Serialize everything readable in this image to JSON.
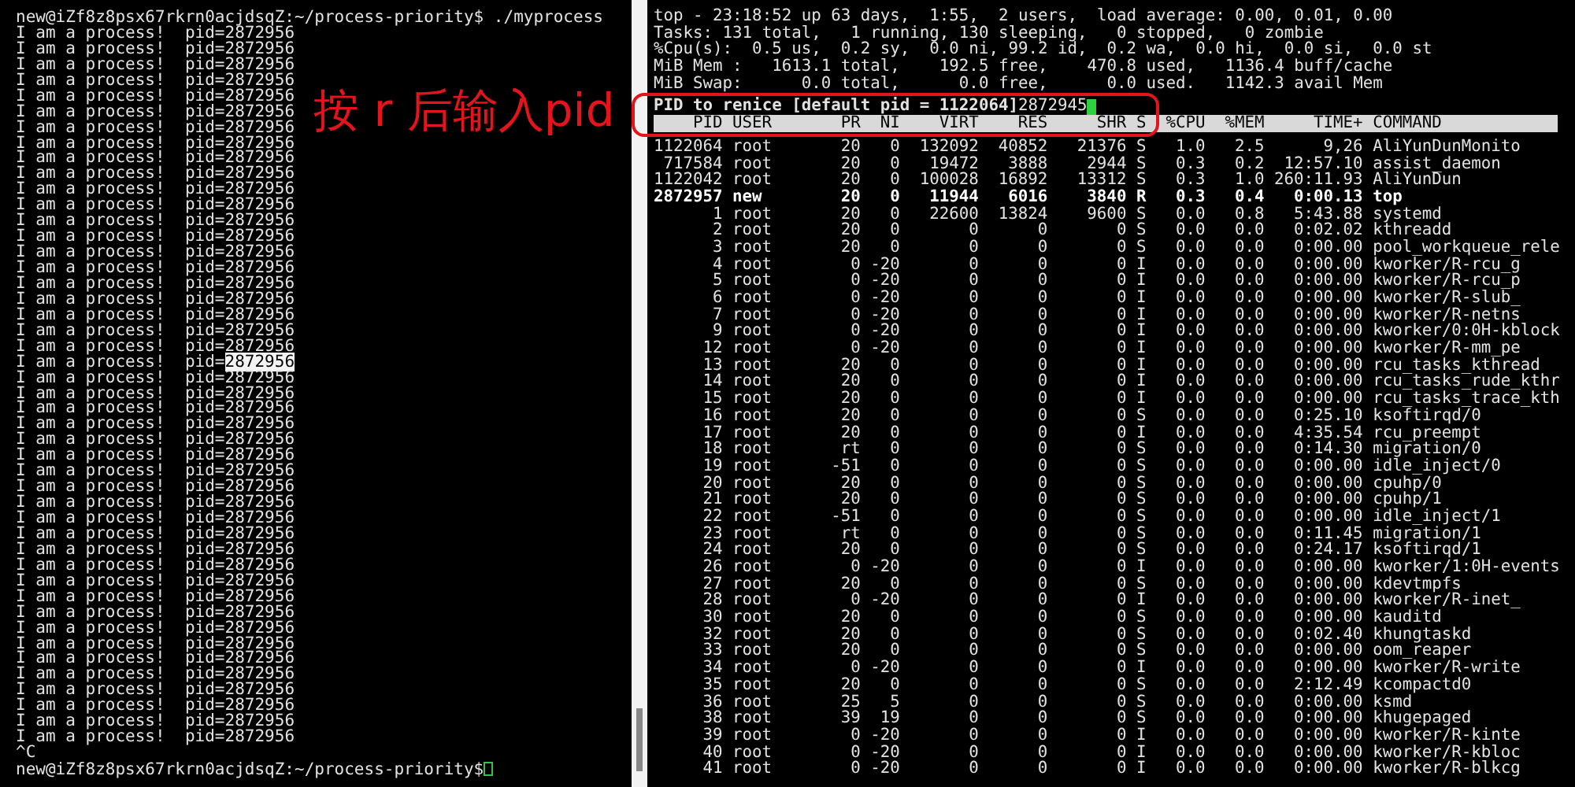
{
  "left_terminal": {
    "command_line": "new@iZf8z8psx67rkrn0acjdsqZ:~/process-priority$ ./myprocess",
    "output_lines": [
      {
        "text": "I am a process!  pid=",
        "pid": "2872956",
        "selected": false
      },
      {
        "text": "I am a process!  pid=",
        "pid": "2872956",
        "selected": false
      },
      {
        "text": "I am a process!  pid=",
        "pid": "2872956",
        "selected": false
      },
      {
        "text": "I am a process!  pid=",
        "pid": "2872956",
        "selected": false
      },
      {
        "text": "I am a process!  pid=",
        "pid": "2872956",
        "selected": false
      },
      {
        "text": "I am a process!  pid=",
        "pid": "2872956",
        "selected": false
      },
      {
        "text": "I am a process!  pid=",
        "pid": "2872956",
        "selected": false
      },
      {
        "text": "I am a process!  pid=",
        "pid": "2872956",
        "selected": false
      },
      {
        "text": "I am a process!  pid=",
        "pid": "2872956",
        "selected": false
      },
      {
        "text": "I am a process!  pid=",
        "pid": "2872956",
        "selected": false
      },
      {
        "text": "I am a process!  pid=",
        "pid": "2872956",
        "selected": false
      },
      {
        "text": "I am a process!  pid=",
        "pid": "2872956",
        "selected": false
      },
      {
        "text": "I am a process!  pid=",
        "pid": "2872956",
        "selected": false
      },
      {
        "text": "I am a process!  pid=",
        "pid": "2872956",
        "selected": false
      },
      {
        "text": "I am a process!  pid=",
        "pid": "2872956",
        "selected": false
      },
      {
        "text": "I am a process!  pid=",
        "pid": "2872956",
        "selected": false
      },
      {
        "text": "I am a process!  pid=",
        "pid": "2872956",
        "selected": false
      },
      {
        "text": "I am a process!  pid=",
        "pid": "2872956",
        "selected": false
      },
      {
        "text": "I am a process!  pid=",
        "pid": "2872956",
        "selected": false
      },
      {
        "text": "I am a process!  pid=",
        "pid": "2872956",
        "selected": false
      },
      {
        "text": "I am a process!  pid=",
        "pid": "2872956",
        "selected": false
      },
      {
        "text": "I am a process!  pid=",
        "pid": "2872956",
        "selected": true
      },
      {
        "text": "I am a process!  pid=",
        "pid": "2872956",
        "selected": false
      },
      {
        "text": "I am a process!  pid=",
        "pid": "2872956",
        "selected": false
      },
      {
        "text": "I am a process!  pid=",
        "pid": "2872956",
        "selected": false
      },
      {
        "text": "I am a process!  pid=",
        "pid": "2872956",
        "selected": false
      },
      {
        "text": "I am a process!  pid=",
        "pid": "2872956",
        "selected": false
      },
      {
        "text": "I am a process!  pid=",
        "pid": "2872956",
        "selected": false
      },
      {
        "text": "I am a process!  pid=",
        "pid": "2872956",
        "selected": false
      },
      {
        "text": "I am a process!  pid=",
        "pid": "2872956",
        "selected": false
      },
      {
        "text": "I am a process!  pid=",
        "pid": "2872956",
        "selected": false
      },
      {
        "text": "I am a process!  pid=",
        "pid": "2872956",
        "selected": false
      },
      {
        "text": "I am a process!  pid=",
        "pid": "2872956",
        "selected": false
      },
      {
        "text": "I am a process!  pid=",
        "pid": "2872956",
        "selected": false
      },
      {
        "text": "I am a process!  pid=",
        "pid": "2872956",
        "selected": false
      },
      {
        "text": "I am a process!  pid=",
        "pid": "2872956",
        "selected": false
      },
      {
        "text": "I am a process!  pid=",
        "pid": "2872956",
        "selected": false
      },
      {
        "text": "I am a process!  pid=",
        "pid": "2872956",
        "selected": false
      },
      {
        "text": "I am a process!  pid=",
        "pid": "2872956",
        "selected": false
      },
      {
        "text": "I am a process!  pid=",
        "pid": "2872956",
        "selected": false
      },
      {
        "text": "I am a process!  pid=",
        "pid": "2872956",
        "selected": false
      },
      {
        "text": "I am a process!  pid=",
        "pid": "2872956",
        "selected": false
      },
      {
        "text": "I am a process!  pid=",
        "pid": "2872956",
        "selected": false
      },
      {
        "text": "I am a process!  pid=",
        "pid": "2872956",
        "selected": false
      },
      {
        "text": "I am a process!  pid=",
        "pid": "2872956",
        "selected": false
      },
      {
        "text": "I am a process!  pid=",
        "pid": "2872956",
        "selected": false
      }
    ],
    "interrupt": "^C",
    "prompt": "new@iZf8z8psx67rkrn0acjdsqZ:~/process-priority$"
  },
  "annotation": {
    "text": "按 r 后输入pid"
  },
  "top": {
    "summary_lines": [
      "top - 23:18:52 up 63 days,  1:55,  2 users,  load average: 0.00, 0.01, 0.00",
      "Tasks: 131 total,   1 running, 130 sleeping,   0 stopped,   0 zombie",
      "%Cpu(s):  0.5 us,  0.2 sy,  0.0 ni, 99.2 id,  0.2 wa,  0.0 hi,  0.0 si,  0.0 st",
      "MiB Mem :   1613.1 total,    192.5 free,    470.8 used,   1136.4 buff/cache",
      "MiB Swap:      0.0 total,      0.0 free,      0.0 used.   1142.3 avail Mem"
    ],
    "renice_prompt": "PID to renice [default pid = 1122064]",
    "renice_input": "2872945",
    "columns": [
      "PID",
      "USER",
      "PR",
      "NI",
      "VIRT",
      "RES",
      "SHR",
      "S",
      "%CPU",
      "%MEM",
      "TIME+",
      "COMMAND"
    ],
    "rows": [
      {
        "cells": [
          "1122064",
          "root",
          "20",
          "0",
          "132092",
          "40852",
          "21376",
          "S",
          "1.0",
          "2.5",
          "9,26",
          "AliYunDunMonito"
        ],
        "highlighted": false
      },
      {
        "cells": [
          "717584",
          "root",
          "20",
          "0",
          "19472",
          "3888",
          "2944",
          "S",
          "0.3",
          "0.2",
          "12:57.10",
          "assist_daemon"
        ],
        "highlighted": false
      },
      {
        "cells": [
          "1122042",
          "root",
          "20",
          "0",
          "100028",
          "16892",
          "13312",
          "S",
          "0.3",
          "1.0",
          "260:11.93",
          "AliYunDun"
        ],
        "highlighted": false
      },
      {
        "cells": [
          "2872957",
          "new",
          "20",
          "0",
          "11944",
          "6016",
          "3840",
          "R",
          "0.3",
          "0.4",
          "0:00.13",
          "top"
        ],
        "highlighted": true
      },
      {
        "cells": [
          "1",
          "root",
          "20",
          "0",
          "22600",
          "13824",
          "9600",
          "S",
          "0.0",
          "0.8",
          "5:43.88",
          "systemd"
        ],
        "highlighted": false
      },
      {
        "cells": [
          "2",
          "root",
          "20",
          "0",
          "0",
          "0",
          "0",
          "S",
          "0.0",
          "0.0",
          "0:02.02",
          "kthreadd"
        ],
        "highlighted": false
      },
      {
        "cells": [
          "3",
          "root",
          "20",
          "0",
          "0",
          "0",
          "0",
          "S",
          "0.0",
          "0.0",
          "0:00.00",
          "pool_workqueue_rele"
        ],
        "highlighted": false
      },
      {
        "cells": [
          "4",
          "root",
          "0",
          "-20",
          "0",
          "0",
          "0",
          "I",
          "0.0",
          "0.0",
          "0:00.00",
          "kworker/R-rcu_g"
        ],
        "highlighted": false
      },
      {
        "cells": [
          "5",
          "root",
          "0",
          "-20",
          "0",
          "0",
          "0",
          "I",
          "0.0",
          "0.0",
          "0:00.00",
          "kworker/R-rcu_p"
        ],
        "highlighted": false
      },
      {
        "cells": [
          "6",
          "root",
          "0",
          "-20",
          "0",
          "0",
          "0",
          "I",
          "0.0",
          "0.0",
          "0:00.00",
          "kworker/R-slub_"
        ],
        "highlighted": false
      },
      {
        "cells": [
          "7",
          "root",
          "0",
          "-20",
          "0",
          "0",
          "0",
          "I",
          "0.0",
          "0.0",
          "0:00.00",
          "kworker/R-netns"
        ],
        "highlighted": false
      },
      {
        "cells": [
          "9",
          "root",
          "0",
          "-20",
          "0",
          "0",
          "0",
          "I",
          "0.0",
          "0.0",
          "0:00.00",
          "kworker/0:0H-kblock"
        ],
        "highlighted": false
      },
      {
        "cells": [
          "12",
          "root",
          "0",
          "-20",
          "0",
          "0",
          "0",
          "I",
          "0.0",
          "0.0",
          "0:00.00",
          "kworker/R-mm_pe"
        ],
        "highlighted": false
      },
      {
        "cells": [
          "13",
          "root",
          "20",
          "0",
          "0",
          "0",
          "0",
          "I",
          "0.0",
          "0.0",
          "0:00.00",
          "rcu_tasks_kthread"
        ],
        "highlighted": false
      },
      {
        "cells": [
          "14",
          "root",
          "20",
          "0",
          "0",
          "0",
          "0",
          "I",
          "0.0",
          "0.0",
          "0:00.00",
          "rcu_tasks_rude_kthr"
        ],
        "highlighted": false
      },
      {
        "cells": [
          "15",
          "root",
          "20",
          "0",
          "0",
          "0",
          "0",
          "I",
          "0.0",
          "0.0",
          "0:00.00",
          "rcu_tasks_trace_kth"
        ],
        "highlighted": false
      },
      {
        "cells": [
          "16",
          "root",
          "20",
          "0",
          "0",
          "0",
          "0",
          "S",
          "0.0",
          "0.0",
          "0:25.10",
          "ksoftirqd/0"
        ],
        "highlighted": false
      },
      {
        "cells": [
          "17",
          "root",
          "20",
          "0",
          "0",
          "0",
          "0",
          "I",
          "0.0",
          "0.0",
          "4:35.54",
          "rcu_preempt"
        ],
        "highlighted": false
      },
      {
        "cells": [
          "18",
          "root",
          "rt",
          "0",
          "0",
          "0",
          "0",
          "S",
          "0.0",
          "0.0",
          "0:14.30",
          "migration/0"
        ],
        "highlighted": false
      },
      {
        "cells": [
          "19",
          "root",
          "-51",
          "0",
          "0",
          "0",
          "0",
          "S",
          "0.0",
          "0.0",
          "0:00.00",
          "idle_inject/0"
        ],
        "highlighted": false
      },
      {
        "cells": [
          "20",
          "root",
          "20",
          "0",
          "0",
          "0",
          "0",
          "S",
          "0.0",
          "0.0",
          "0:00.00",
          "cpuhp/0"
        ],
        "highlighted": false
      },
      {
        "cells": [
          "21",
          "root",
          "20",
          "0",
          "0",
          "0",
          "0",
          "S",
          "0.0",
          "0.0",
          "0:00.00",
          "cpuhp/1"
        ],
        "highlighted": false
      },
      {
        "cells": [
          "22",
          "root",
          "-51",
          "0",
          "0",
          "0",
          "0",
          "S",
          "0.0",
          "0.0",
          "0:00.00",
          "idle_inject/1"
        ],
        "highlighted": false
      },
      {
        "cells": [
          "23",
          "root",
          "rt",
          "0",
          "0",
          "0",
          "0",
          "S",
          "0.0",
          "0.0",
          "0:11.45",
          "migration/1"
        ],
        "highlighted": false
      },
      {
        "cells": [
          "24",
          "root",
          "20",
          "0",
          "0",
          "0",
          "0",
          "S",
          "0.0",
          "0.0",
          "0:24.17",
          "ksoftirqd/1"
        ],
        "highlighted": false
      },
      {
        "cells": [
          "26",
          "root",
          "0",
          "-20",
          "0",
          "0",
          "0",
          "I",
          "0.0",
          "0.0",
          "0:00.00",
          "kworker/1:0H-events"
        ],
        "highlighted": false
      },
      {
        "cells": [
          "27",
          "root",
          "20",
          "0",
          "0",
          "0",
          "0",
          "S",
          "0.0",
          "0.0",
          "0:00.00",
          "kdevtmpfs"
        ],
        "highlighted": false
      },
      {
        "cells": [
          "28",
          "root",
          "0",
          "-20",
          "0",
          "0",
          "0",
          "I",
          "0.0",
          "0.0",
          "0:00.00",
          "kworker/R-inet_"
        ],
        "highlighted": false
      },
      {
        "cells": [
          "30",
          "root",
          "20",
          "0",
          "0",
          "0",
          "0",
          "S",
          "0.0",
          "0.0",
          "0:00.00",
          "kauditd"
        ],
        "highlighted": false
      },
      {
        "cells": [
          "32",
          "root",
          "20",
          "0",
          "0",
          "0",
          "0",
          "S",
          "0.0",
          "0.0",
          "0:02.40",
          "khungtaskd"
        ],
        "highlighted": false
      },
      {
        "cells": [
          "33",
          "root",
          "20",
          "0",
          "0",
          "0",
          "0",
          "S",
          "0.0",
          "0.0",
          "0:00.00",
          "oom_reaper"
        ],
        "highlighted": false
      },
      {
        "cells": [
          "34",
          "root",
          "0",
          "-20",
          "0",
          "0",
          "0",
          "I",
          "0.0",
          "0.0",
          "0:00.00",
          "kworker/R-write"
        ],
        "highlighted": false
      },
      {
        "cells": [
          "35",
          "root",
          "20",
          "0",
          "0",
          "0",
          "0",
          "S",
          "0.0",
          "0.0",
          "2:12.49",
          "kcompactd0"
        ],
        "highlighted": false
      },
      {
        "cells": [
          "36",
          "root",
          "25",
          "5",
          "0",
          "0",
          "0",
          "S",
          "0.0",
          "0.0",
          "0:00.00",
          "ksmd"
        ],
        "highlighted": false
      },
      {
        "cells": [
          "38",
          "root",
          "39",
          "19",
          "0",
          "0",
          "0",
          "S",
          "0.0",
          "0.0",
          "0:00.00",
          "khugepaged"
        ],
        "highlighted": false
      },
      {
        "cells": [
          "39",
          "root",
          "0",
          "-20",
          "0",
          "0",
          "0",
          "I",
          "0.0",
          "0.0",
          "0:00.00",
          "kworker/R-kinte"
        ],
        "highlighted": false
      },
      {
        "cells": [
          "40",
          "root",
          "0",
          "-20",
          "0",
          "0",
          "0",
          "I",
          "0.0",
          "0.0",
          "0:00.00",
          "kworker/R-kbloc"
        ],
        "highlighted": false
      },
      {
        "cells": [
          "41",
          "root",
          "0",
          "-20",
          "0",
          "0",
          "0",
          "I",
          "0.0",
          "0.0",
          "0:00.00",
          "kworker/R-blkcg"
        ],
        "highlighted": false
      }
    ]
  }
}
